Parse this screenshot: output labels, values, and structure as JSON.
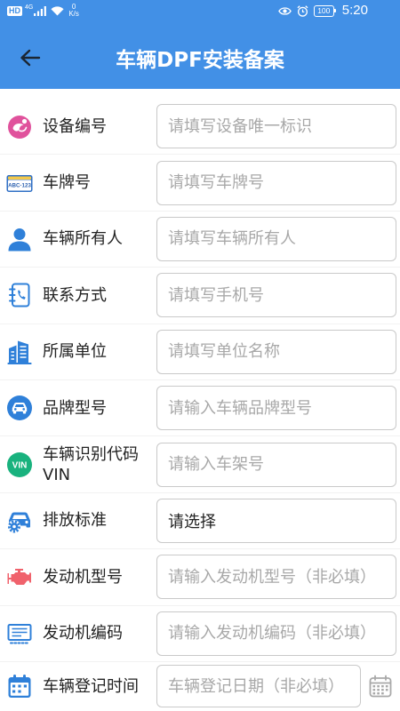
{
  "status_bar": {
    "hd_badge": "HD",
    "network_type": "4G",
    "net_speed_value": "0",
    "net_speed_unit": "K/s",
    "battery_level": "100",
    "time": "5:20"
  },
  "header": {
    "title": "车辆DPF安装备案",
    "back_icon": "back-arrow-icon"
  },
  "colors": {
    "primary": "#4290e6",
    "icon_blue": "#2f80d9",
    "icon_pink": "#e0529c",
    "icon_red": "#f0626c",
    "icon_green": "#19b27e",
    "label_text": "#222222",
    "placeholder_text": "#a8a8a8",
    "input_border": "#c9c9c9"
  },
  "form": {
    "rows": [
      {
        "label": "设备编号",
        "icon": "device-icon",
        "placeholder": "请填写设备唯一标识"
      },
      {
        "label": "车牌号",
        "icon": "license-plate-icon",
        "icon_text": "ABC·123",
        "placeholder": "请填写车牌号"
      },
      {
        "label": "车辆所有人",
        "icon": "person-icon",
        "placeholder": "请填写车辆所有人"
      },
      {
        "label": "联系方式",
        "icon": "contact-book-icon",
        "placeholder": "请填写手机号"
      },
      {
        "label": "所属单位",
        "icon": "building-icon",
        "placeholder": "请填写单位名称"
      },
      {
        "label": "品牌型号",
        "icon": "car-icon",
        "placeholder": "请输入车辆品牌型号"
      },
      {
        "label": "车辆识别代码",
        "label_line2": "VIN",
        "icon": "vin-icon",
        "icon_text": "VIN",
        "placeholder": "请输入车架号"
      },
      {
        "label": "排放标准",
        "icon": "emission-car-icon",
        "value": "请选择"
      },
      {
        "label": "发动机型号",
        "icon": "engine-icon",
        "placeholder": "请输入发动机型号（非必填）"
      },
      {
        "label": "发动机编码",
        "icon": "engine-code-icon",
        "placeholder": "请输入发动机编码（非必填）"
      },
      {
        "label": "车辆登记时间",
        "icon": "calendar-icon",
        "placeholder": "车辆登记日期（非必填）",
        "picker_icon": "date-picker-icon"
      }
    ]
  }
}
